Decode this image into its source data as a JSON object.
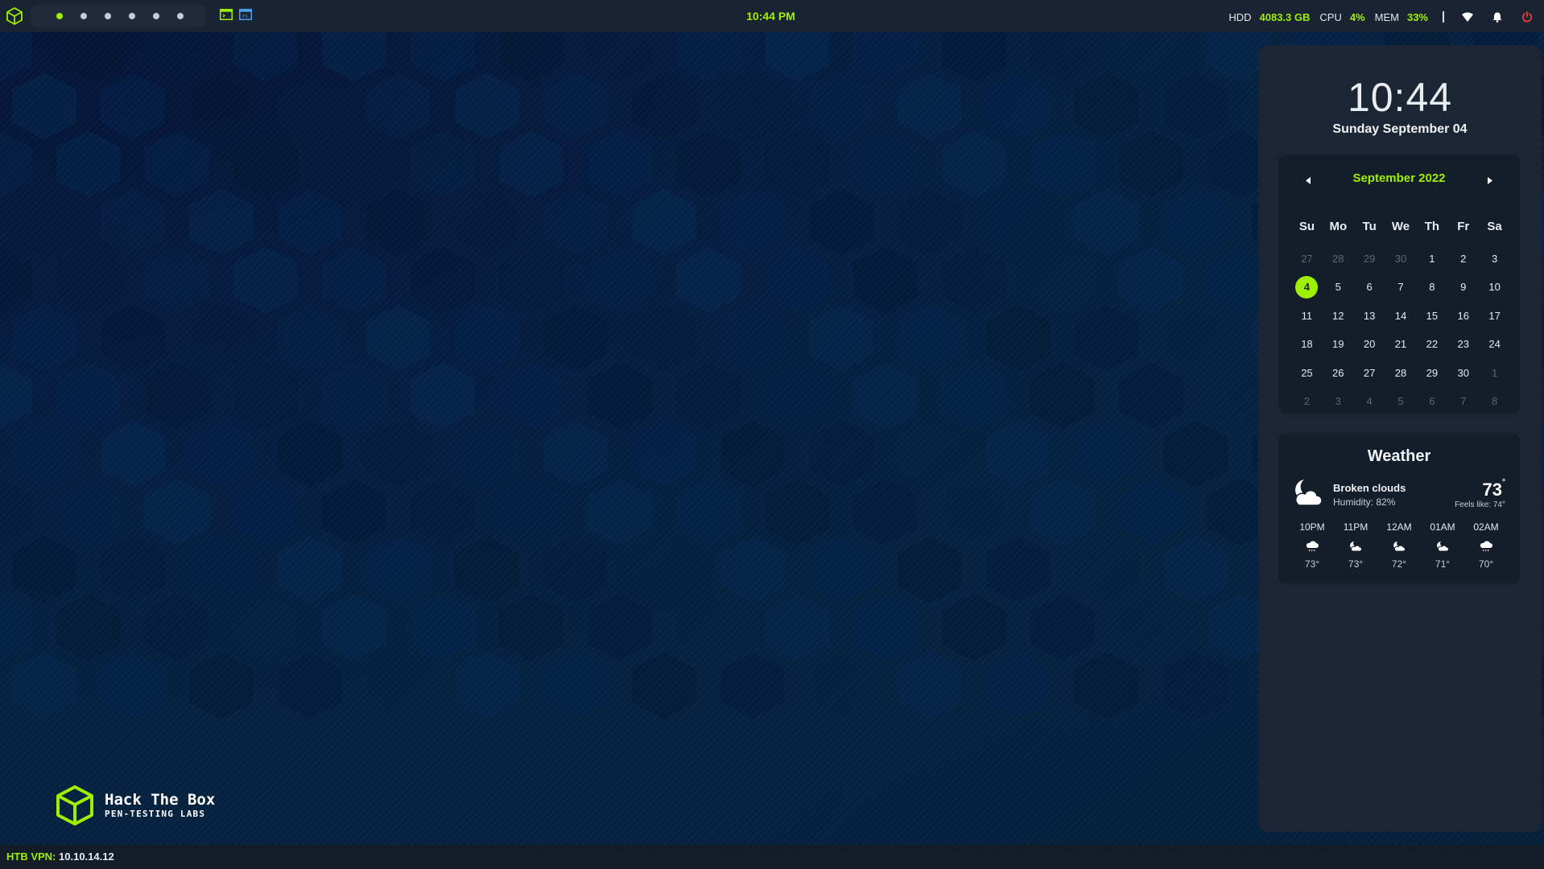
{
  "topbar": {
    "workspaces": [
      {
        "id": 1,
        "active": true
      },
      {
        "id": 2,
        "active": false
      },
      {
        "id": 3,
        "active": false
      },
      {
        "id": 4,
        "active": false
      },
      {
        "id": 5,
        "active": false
      },
      {
        "id": 6,
        "active": false
      }
    ],
    "clock": "10:44 PM",
    "hdd_label": "HDD",
    "hdd_value": "4083.3 GB",
    "cpu_label": "CPU",
    "cpu_value": "4%",
    "mem_label": "MEM",
    "mem_value": "33%",
    "icons": [
      "htb-cube-icon",
      "terminal-icon",
      "powershell-icon",
      "wifi-icon",
      "bell-icon",
      "power-icon"
    ]
  },
  "panel": {
    "time": "10:44",
    "date": "Sunday September 04",
    "calendar": {
      "month_label": "September 2022",
      "weekdays": [
        "Su",
        "Mo",
        "Tu",
        "We",
        "Th",
        "Fr",
        "Sa"
      ],
      "weeks": [
        [
          {
            "d": "27",
            "dim": true
          },
          {
            "d": "28",
            "dim": true
          },
          {
            "d": "29",
            "dim": true
          },
          {
            "d": "30",
            "dim": true
          },
          {
            "d": "1"
          },
          {
            "d": "2"
          },
          {
            "d": "3"
          }
        ],
        [
          {
            "d": "4",
            "today": true
          },
          {
            "d": "5"
          },
          {
            "d": "6"
          },
          {
            "d": "7"
          },
          {
            "d": "8"
          },
          {
            "d": "9"
          },
          {
            "d": "10"
          }
        ],
        [
          {
            "d": "11"
          },
          {
            "d": "12"
          },
          {
            "d": "13"
          },
          {
            "d": "14"
          },
          {
            "d": "15"
          },
          {
            "d": "16"
          },
          {
            "d": "17"
          }
        ],
        [
          {
            "d": "18"
          },
          {
            "d": "19"
          },
          {
            "d": "20"
          },
          {
            "d": "21"
          },
          {
            "d": "22"
          },
          {
            "d": "23"
          },
          {
            "d": "24"
          }
        ],
        [
          {
            "d": "25"
          },
          {
            "d": "26"
          },
          {
            "d": "27"
          },
          {
            "d": "28"
          },
          {
            "d": "29"
          },
          {
            "d": "30"
          },
          {
            "d": "1",
            "dim": true
          }
        ],
        [
          {
            "d": "2",
            "dim": true
          },
          {
            "d": "3",
            "dim": true
          },
          {
            "d": "4",
            "dim": true
          },
          {
            "d": "5",
            "dim": true
          },
          {
            "d": "6",
            "dim": true
          },
          {
            "d": "7",
            "dim": true
          },
          {
            "d": "8",
            "dim": true
          }
        ]
      ]
    },
    "weather": {
      "title": "Weather",
      "description": "Broken clouds",
      "humidity": "Humidity: 82%",
      "temp": "73",
      "feels_like": "Feels like: 74°",
      "hourly": [
        {
          "time": "10PM",
          "temp": "73°",
          "icon": "rain-cloud-icon"
        },
        {
          "time": "11PM",
          "temp": "73°",
          "icon": "moon-cloud-icon"
        },
        {
          "time": "12AM",
          "temp": "72°",
          "icon": "moon-cloud-icon"
        },
        {
          "time": "01AM",
          "temp": "71°",
          "icon": "moon-cloud-icon"
        },
        {
          "time": "02AM",
          "temp": "70°",
          "icon": "rain-cloud-icon"
        }
      ]
    }
  },
  "brand": {
    "title": "Hack The Box",
    "subtitle": "PEN-TESTING LABS"
  },
  "bottombar": {
    "vpn_label": "HTB VPN:",
    "vpn_ip": "10.10.14.12"
  },
  "colors": {
    "accent": "#9fef00",
    "bar": "#1a2332",
    "panel": "#1c2533",
    "card": "#141d2a",
    "power": "#ff3e3e"
  }
}
